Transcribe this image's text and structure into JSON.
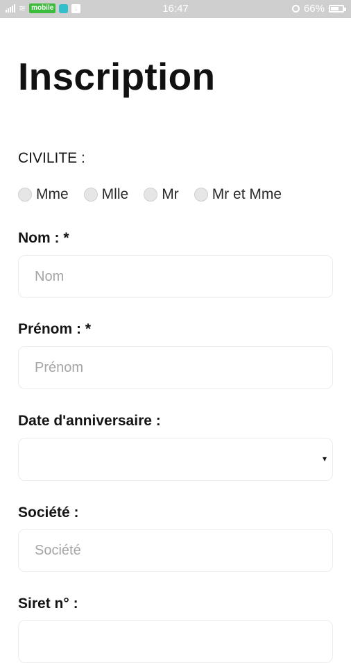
{
  "status_bar": {
    "carrier": "mobile",
    "time": "16:47",
    "battery": "66%",
    "battery_level": 0.66,
    "icons": [
      "signal-icon",
      "wifi-icon",
      "app-icon",
      "download-icon",
      "alarm-icon",
      "battery-icon"
    ]
  },
  "page": {
    "title": "Inscription"
  },
  "form": {
    "civilite": {
      "label": "CIVILITE :",
      "options": [
        "Mme",
        "Mlle",
        "Mr",
        "Mr et Mme"
      ]
    },
    "nom": {
      "label": "Nom : *",
      "placeholder": "Nom",
      "value": ""
    },
    "prenom": {
      "label": "Prénom : *",
      "placeholder": "Prénom",
      "value": ""
    },
    "date": {
      "label": "Date d'anniversaire :",
      "value": "",
      "arrow": "▾"
    },
    "societe": {
      "label": "Société :",
      "placeholder": "Société",
      "value": ""
    },
    "siret": {
      "label": "Siret n° :",
      "placeholder": "",
      "value": ""
    }
  }
}
